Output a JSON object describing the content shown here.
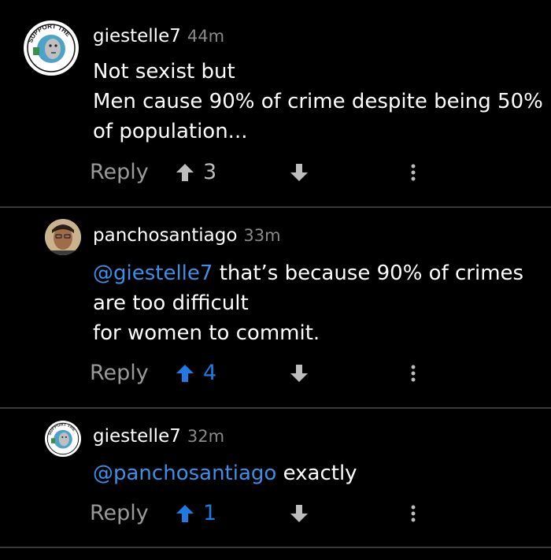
{
  "colors": {
    "background": "#000000",
    "mention": "#3d8fe8",
    "upvote_active": "#1f7ae3",
    "muted": "#9a9a9a"
  },
  "comments": [
    {
      "username": "giestelle7",
      "time": "44m",
      "lines": [
        "Not sexist but",
        "Men cause 90% of crime despite being 50%",
        "of population..."
      ],
      "reply_label": "Reply",
      "upvotes": "3",
      "upvote_active": false,
      "avatar": {
        "badge_top": "SUPPORT THE",
        "badge_bottom": "DEPORTATION OF CONVICTED"
      }
    },
    {
      "username": "panchosantiago",
      "time": "33m",
      "mention": "@giestelle7",
      "first_line_rest": " that’s because 90% of crimes",
      "lines": [
        "are too difficult",
        "for women to commit."
      ],
      "reply_label": "Reply",
      "upvotes": "4",
      "upvote_active": true
    },
    {
      "username": "giestelle7",
      "time": "32m",
      "mention": "@panchosantiago",
      "first_line_rest": " exactly",
      "reply_label": "Reply",
      "upvotes": "1",
      "upvote_active": true,
      "avatar": {
        "badge_top": "SUPPORT THE",
        "badge_bottom": "DEPORTATION OF CONVICTED"
      }
    }
  ]
}
